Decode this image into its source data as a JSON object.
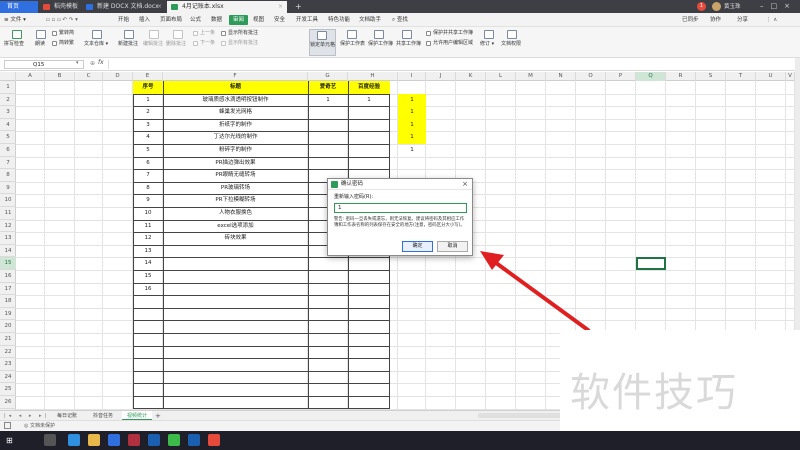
{
  "titlebar": {
    "tabs": [
      {
        "label": "首页",
        "icon": "home-icon",
        "color": "#2f6fe0"
      },
      {
        "label": "稻壳模板",
        "icon": "docer-icon",
        "color": "#e64a3b"
      },
      {
        "label": "新建 DOCX 文档.docx",
        "icon": "word-icon",
        "color": "#2f6fe0"
      },
      {
        "label": "4月记账本.xlsx",
        "icon": "excel-icon",
        "color": "#2f9b5b"
      }
    ],
    "add_tab": "+",
    "right": {
      "count": "1",
      "user": "黄玉珠"
    }
  },
  "menubar": {
    "file": "文件",
    "items": [
      "开始",
      "插入",
      "页面布局",
      "公式",
      "数据",
      "审阅",
      "视图",
      "安全",
      "开发工具",
      "特色功能",
      "文档助手"
    ],
    "active": "审阅",
    "search": "查找",
    "right": [
      "已同步",
      "协作",
      "分享"
    ]
  },
  "toolbar": {
    "groups": [
      {
        "label": "拼写检查",
        "dim": false
      },
      {
        "label": "朗读",
        "dim": false
      },
      {
        "label": "繁转简",
        "dim": false
      },
      {
        "label": "简转繁",
        "dim": false
      },
      {
        "label": "文本仓库",
        "dim": false
      },
      {
        "label": "新建批注",
        "dim": false
      },
      {
        "label": "编辑批注",
        "dim": true
      },
      {
        "label": "删除批注",
        "dim": true
      },
      {
        "label": "上一条",
        "dim": true
      },
      {
        "label": "下一条",
        "dim": true
      },
      {
        "label": "显示所有批注",
        "dim": false
      },
      {
        "label": "显示所有批注",
        "dim": true
      },
      {
        "label": "锁定单元格",
        "dim": false
      },
      {
        "label": "保护工作表",
        "dim": false
      },
      {
        "label": "保护工作簿",
        "dim": false
      },
      {
        "label": "共享工作簿",
        "dim": false
      },
      {
        "label": "保护并共享工作簿",
        "dim": false
      },
      {
        "label": "允许用户编辑区域",
        "dim": false
      },
      {
        "label": "修订",
        "dim": false
      },
      {
        "label": "文档权限",
        "dim": false
      }
    ]
  },
  "formulabar": {
    "cell_ref": "Q15",
    "fx": "fx"
  },
  "columns": [
    "A",
    "B",
    "C",
    "D",
    "E",
    "F",
    "G",
    "H",
    "I",
    "J",
    "K",
    "L",
    "M",
    "N",
    "O",
    "P",
    "Q",
    "R",
    "S",
    "T",
    "U",
    "V"
  ],
  "selected_column": "Q",
  "rows": [
    "1",
    "2",
    "3",
    "4",
    "5",
    "6",
    "7",
    "8",
    "9",
    "10",
    "11",
    "12",
    "13",
    "14",
    "15",
    "16",
    "17",
    "18",
    "19",
    "20",
    "21",
    "22",
    "23",
    "24",
    "25",
    "26"
  ],
  "selected_row": "15",
  "table": {
    "headers": [
      "序号",
      "标题",
      "爱奇艺",
      "百度经验"
    ],
    "rows": [
      {
        "no": "1",
        "title": "玻璃质感水滴透明按钮制作",
        "iqiyi": "1",
        "baidu": "1",
        "i": "1"
      },
      {
        "no": "2",
        "title": "蜂巢发光网格",
        "iqiyi": "",
        "baidu": "",
        "i": "1"
      },
      {
        "no": "3",
        "title": "折纸字的制作",
        "iqiyi": "",
        "baidu": "",
        "i": "1"
      },
      {
        "no": "4",
        "title": "丁达尔光线的制作",
        "iqiyi": "",
        "baidu": "",
        "i": "1"
      },
      {
        "no": "5",
        "title": "粉碎字的制作",
        "iqiyi": "",
        "baidu": "",
        "i": "1"
      },
      {
        "no": "6",
        "title": "PR描边弹出效果",
        "iqiyi": "",
        "baidu": "",
        "i": ""
      },
      {
        "no": "7",
        "title": "PR眼睛无缝转场",
        "iqiyi": "",
        "baidu": "",
        "i": ""
      },
      {
        "no": "8",
        "title": "PR玻璃转场",
        "iqiyi": "",
        "baidu": "",
        "i": ""
      },
      {
        "no": "9",
        "title": "PR下拉模糊转场",
        "iqiyi": "",
        "baidu": "",
        "i": ""
      },
      {
        "no": "10",
        "title": "人物衣服换色",
        "iqiyi": "",
        "baidu": "",
        "i": ""
      },
      {
        "no": "11",
        "title": "excel选项添加",
        "iqiyi": "",
        "baidu": "",
        "i": ""
      },
      {
        "no": "12",
        "title": "砖块效果",
        "iqiyi": "",
        "baidu": "",
        "i": ""
      },
      {
        "no": "13",
        "title": "",
        "iqiyi": "",
        "baidu": "",
        "i": ""
      },
      {
        "no": "14",
        "title": "",
        "iqiyi": "",
        "baidu": "",
        "i": ""
      },
      {
        "no": "15",
        "title": "",
        "iqiyi": "",
        "baidu": "",
        "i": ""
      },
      {
        "no": "16",
        "title": "",
        "iqiyi": "",
        "baidu": "",
        "i": ""
      }
    ],
    "header_color": "#ffff00"
  },
  "dialog": {
    "title": "确认密码",
    "label": "重新输入密码(R):",
    "value": "1",
    "warning": "警告: 密码一旦丢失或遗忘，则无法恢复。建议将密码及其相应工作簿和工作表名称的列表保存在安全的地方(注意，密码区分大小写)。",
    "ok": "确定",
    "cancel": "取消",
    "close": "×"
  },
  "sheets": {
    "items": [
      "每日记账",
      "抖音任务",
      "视频统计"
    ],
    "active": "视频统计",
    "add": "+"
  },
  "statusbar": {
    "text": "文档未保护"
  },
  "watermark": "软件技巧",
  "accent": "#2f9b5b",
  "arrow_color": "#e02020"
}
